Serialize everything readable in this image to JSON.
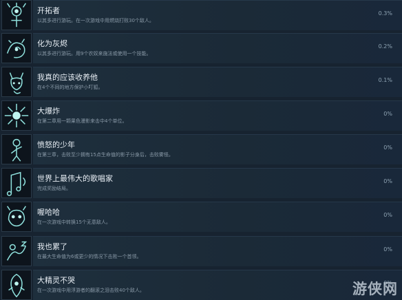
{
  "achievements": [
    {
      "title": "开拓者",
      "description": "以其多进行游玩。在一次游戏中用燃烧打败30个敌人。",
      "percent": "0.3%",
      "icon": "pioneer-icon"
    },
    {
      "title": "化为灰烬",
      "description": "以其多进行游玩。用9个农奴来施法或使用一个技能。",
      "percent": "0.2%",
      "icon": "ashes-icon"
    },
    {
      "title": "我真的应该收养他",
      "description": "在4个不同的地方保护小叮狐。",
      "percent": "0.1%",
      "icon": "fox-spirit-icon"
    },
    {
      "title": "大爆炸",
      "description": "在第二章用一颗果色漫影来击中4个单位。",
      "percent": "0%",
      "icon": "explosion-icon"
    },
    {
      "title": "愤怒的少年",
      "description": "在第三章，击败至少拥有15点生命值的影子分身后，击败雾怪。",
      "percent": "0%",
      "icon": "angry-youth-icon"
    },
    {
      "title": "世界上最伟大的歌唱家",
      "description": "完成奖励结局。",
      "percent": "0%",
      "icon": "singer-icon"
    },
    {
      "title": "喔哈哈",
      "description": "在一次游戏中转换15个无意敌人。",
      "percent": "0%",
      "icon": "owl-icon"
    },
    {
      "title": "我也累了",
      "description": "在最大生命值为6或更少的情况下击败一个首领。",
      "percent": "0%",
      "icon": "tired-icon"
    },
    {
      "title": "大精灵不哭",
      "description": "在一次游戏中用浮游者的翻滚之泪击败40个敌人。",
      "percent": "0%",
      "icon": "spirit-icon"
    }
  ],
  "watermark": "游侠网",
  "colors": {
    "background": "#172330",
    "icon_glow": "#8fe0dc"
  }
}
